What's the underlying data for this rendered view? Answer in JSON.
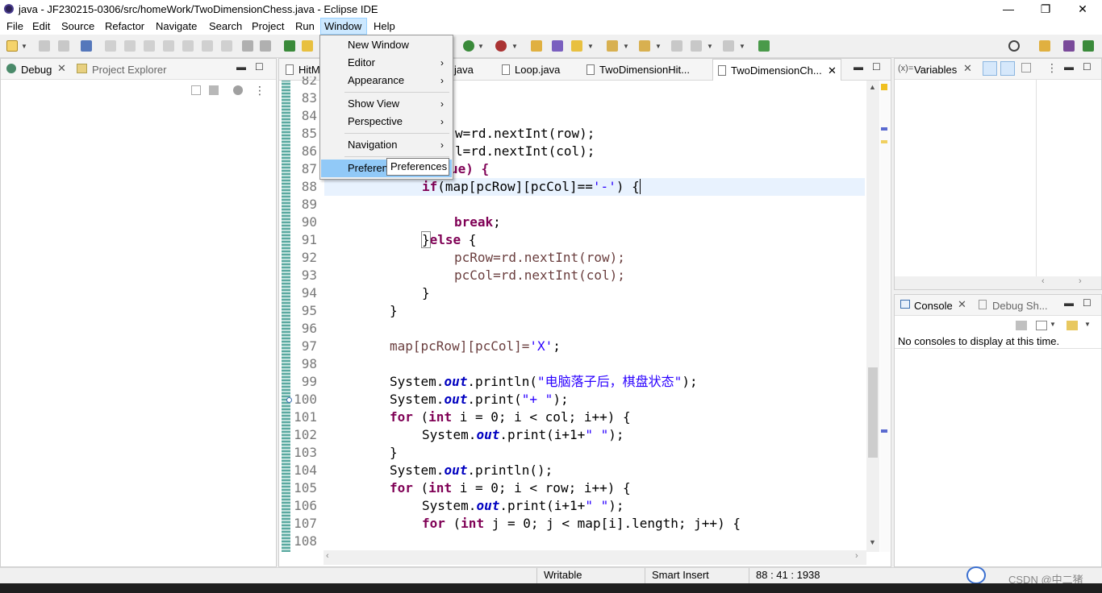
{
  "window": {
    "title": "java - JF230215-0306/src/homeWork/TwoDimensionChess.java - Eclipse IDE",
    "minimize": "—",
    "restore": "❐",
    "close": "✕"
  },
  "menubar": [
    "File",
    "Edit",
    "Source",
    "Refactor",
    "Navigate",
    "Search",
    "Project",
    "Run",
    "Window",
    "Help"
  ],
  "window_menu": {
    "items": [
      {
        "label": "New Window",
        "submenu": false
      },
      {
        "label": "Editor",
        "submenu": true
      },
      {
        "label": "Appearance",
        "submenu": true
      },
      {
        "label": "Show View",
        "submenu": true
      },
      {
        "label": "Perspective",
        "submenu": true
      },
      {
        "label": "Navigation",
        "submenu": true
      },
      {
        "label": "Preferen",
        "submenu": false
      }
    ],
    "submenu_arrow": "›",
    "tooltip": "Preferences"
  },
  "left_panel": {
    "tabs": [
      {
        "label": "Debug",
        "close": "✕"
      },
      {
        "label": "Project Explorer"
      }
    ]
  },
  "editor": {
    "tabs": [
      {
        "label": "HitM"
      },
      {
        "label": "java"
      },
      {
        "label": "Loop.java"
      },
      {
        "label": "TwoDimensionHit..."
      },
      {
        "label": "TwoDimensionCh...",
        "close": "✕"
      }
    ],
    "lines": [
      {
        "n": "82"
      },
      {
        "n": "83"
      },
      {
        "n": "84"
      },
      {
        "n": "85"
      },
      {
        "n": "86"
      },
      {
        "n": "87"
      },
      {
        "n": "88"
      },
      {
        "n": "89"
      },
      {
        "n": "90"
      },
      {
        "n": "91"
      },
      {
        "n": "92"
      },
      {
        "n": "93"
      },
      {
        "n": "94"
      },
      {
        "n": "95"
      },
      {
        "n": "96"
      },
      {
        "n": "97"
      },
      {
        "n": "98"
      },
      {
        "n": "99"
      },
      {
        "n": "100"
      },
      {
        "n": "101"
      },
      {
        "n": "102"
      },
      {
        "n": "103"
      },
      {
        "n": "104"
      },
      {
        "n": "105"
      },
      {
        "n": "106"
      },
      {
        "n": "107"
      },
      {
        "n": "108"
      }
    ],
    "code": {
      "l85": "w=rd.nextInt(row);",
      "l86": "l=rd.nextInt(col);",
      "l87": "ue) {",
      "l88_if": "if",
      "l88_a": "(map[pcRow][pcCol]==",
      "l88_str": "'-'",
      "l88_b": ") {",
      "l90": "break",
      "l91_a": "}",
      "l91_kw": "else",
      "l91_b": " {",
      "l92": "pcRow=rd.nextInt(row);",
      "l93": "pcCol=rd.nextInt(col);",
      "l94": "}",
      "l95": "}",
      "l97_a": "map[pcRow][pcCol]=",
      "l97_str": "'X'",
      "l99_a": "System.",
      "l99_out": "out",
      "l99_b": ".println(",
      "l99_str": "\"电脑落子后，棋盘状态\"",
      "l99_c": ");",
      "l100_str": "\"+ \"",
      "l100_b": ".print(",
      "l101_for": "for",
      "l101_int": "int",
      "l101_rest": " i = 0; i < col; i++) {",
      "l102_b": ".print(i+1+",
      "l102_str": "\" \"",
      "l103": "}",
      "l104_b": ".println();",
      "l105_rest": " i = 0; i < row; i++) {",
      "l107_rest": " j = 0; j < map[i].length; j++) {"
    }
  },
  "variables_panel": {
    "label": "Variables",
    "close": "✕"
  },
  "console_panel": {
    "tabs": [
      {
        "label": "Console",
        "close": "✕"
      },
      {
        "label": "Debug Sh..."
      }
    ],
    "message": "No consoles to display at this time."
  },
  "statusbar": {
    "writable": "Writable",
    "insert_mode": "Smart Insert",
    "position": "88 : 41 : 1938"
  },
  "watermark": "CSDN @中二猪"
}
